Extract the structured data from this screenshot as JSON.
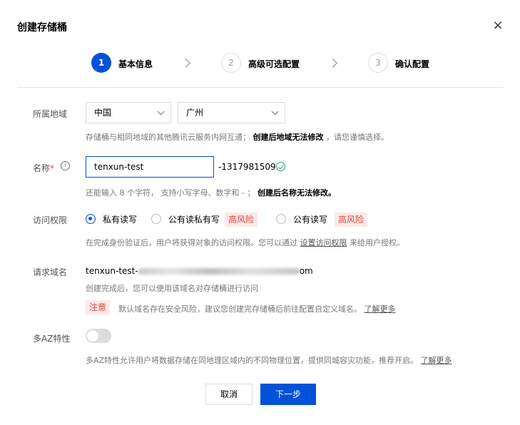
{
  "dialog": {
    "title": "创建存储桶",
    "close_glyph": "×"
  },
  "steps": [
    {
      "number": "1",
      "label": "基本信息",
      "state": "active"
    },
    {
      "number": "2",
      "label": "高级可选配置",
      "state": "idle"
    },
    {
      "number": "3",
      "label": "确认配置",
      "state": "idle"
    }
  ],
  "region": {
    "label": "所属地域",
    "country": "中国",
    "city": "广州",
    "hint_prefix": "存储桶与相同地域的其他腾讯云服务内网互通；",
    "hint_bold": "创建后地域无法修改",
    "hint_suffix": "，请您谨慎选择。"
  },
  "name": {
    "label": "名称",
    "required_mark": "*",
    "info_glyph": "i",
    "value": "tenxun-test",
    "suffix": "-1317981509",
    "hint_prefix": "还能输入 8 个字符， 支持小写字母、数字和 - ；",
    "hint_bold": "创建后名称无法修改。"
  },
  "access": {
    "label": "访问权限",
    "options": [
      {
        "label": "私有读写",
        "selected": true,
        "risk": ""
      },
      {
        "label": "公有读私有写",
        "selected": false,
        "risk": "高风险"
      },
      {
        "label": "公有读写",
        "selected": false,
        "risk": "高风险"
      }
    ],
    "hint_prefix": "在完成身份验证后，用户将获得对象的访问权限。您可以通过",
    "hint_link": "设置访问权限",
    "hint_suffix": "来给用户授权。"
  },
  "domain": {
    "label": "请求域名",
    "prefix": "tenxun-test-",
    "suffix": "om",
    "hint": "创建完成后，您可以使用该域名对存储桶进行访问",
    "notice_tag": "注意",
    "notice_text": "默认域名存在安全风险，建议您创建完存储桶后前往配置自定义域名。",
    "notice_link": "了解更多"
  },
  "multi_az": {
    "label": "多AZ特性",
    "enabled": false,
    "hint": "多AZ特性允许用户将数据存储在同地理区域内的不同物理位置，提供同城容灾功能，推荐开启。",
    "hint_link": "了解更多"
  },
  "footer": {
    "cancel_label": "取消",
    "next_label": "下一步"
  },
  "colors": {
    "primary": "#0052d9",
    "success": "#2ba471",
    "danger": "#d54941",
    "danger_bg": "#fde9e8"
  }
}
